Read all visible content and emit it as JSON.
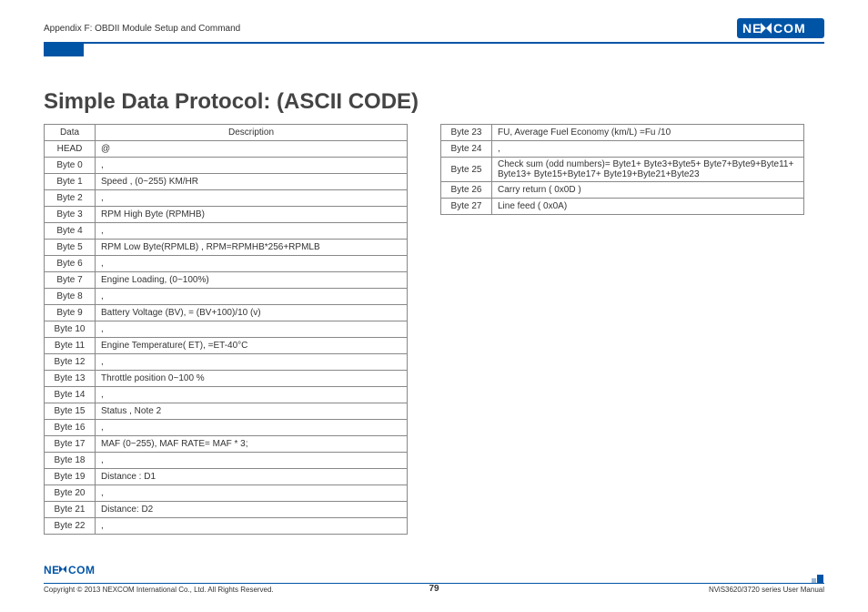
{
  "header": {
    "appendix": "Appendix F: OBDII Module Setup and Command",
    "brand": "NEXCOM"
  },
  "title": "Simple Data Protocol: (ASCII CODE)",
  "table1": {
    "head": [
      "Data",
      "Description"
    ],
    "rows": [
      [
        "HEAD",
        "@"
      ],
      [
        "Byte 0",
        ","
      ],
      [
        "Byte 1",
        "Speed , (0~255) KM/HR"
      ],
      [
        "Byte 2",
        ","
      ],
      [
        "Byte 3",
        "RPM High Byte (RPMHB)"
      ],
      [
        "Byte 4",
        ","
      ],
      [
        "Byte 5",
        "RPM Low Byte(RPMLB) , RPM=RPMHB*256+RPMLB"
      ],
      [
        "Byte 6",
        ","
      ],
      [
        "Byte 7",
        "Engine Loading, (0~100%)"
      ],
      [
        "Byte 8",
        ","
      ],
      [
        "Byte 9",
        "Battery Voltage (BV), = (BV+100)/10 (v)"
      ],
      [
        "Byte 10",
        ","
      ],
      [
        "Byte 11",
        "Engine Temperature( ET), =ET-40°C"
      ],
      [
        "Byte 12",
        ","
      ],
      [
        "Byte 13",
        "Throttle position 0~100 %"
      ],
      [
        "Byte 14",
        ","
      ],
      [
        "Byte 15",
        "Status , Note 2"
      ],
      [
        "Byte 16",
        ","
      ],
      [
        "Byte 17",
        "MAF (0~255), MAF RATE= MAF * 3;"
      ],
      [
        "Byte 18",
        ","
      ],
      [
        "Byte 19",
        "Distance : D1"
      ],
      [
        "Byte 20",
        ","
      ],
      [
        "Byte 21",
        "Distance: D2"
      ],
      [
        "Byte 22",
        ","
      ]
    ]
  },
  "table2": {
    "rows": [
      [
        "Byte 23",
        "FU, Average Fuel Economy (km/L) =Fu /10"
      ],
      [
        "Byte 24",
        ","
      ],
      [
        "Byte 25",
        "Check sum (odd numbers)= Byte1+ Byte3+Byte5+ Byte7+Byte9+Byte11+ Byte13+ Byte15+Byte17+ Byte19+Byte21+Byte23"
      ],
      [
        "Byte 26",
        "Carry return ( 0x0D )"
      ],
      [
        "Byte 27",
        "Line feed ( 0x0A)"
      ]
    ]
  },
  "footer": {
    "copyright": "Copyright © 2013 NEXCOM International Co., Ltd. All Rights Reserved.",
    "page": "79",
    "manual": "NViS3620/3720 series User Manual",
    "brand": "NEXCOM"
  }
}
